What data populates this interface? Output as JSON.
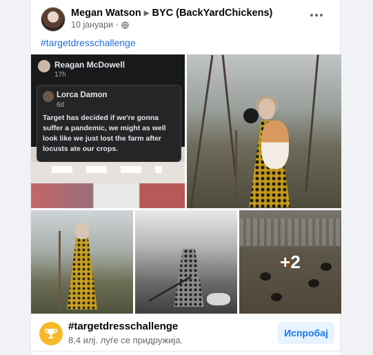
{
  "post": {
    "author": "Megan Watson",
    "group": "BYC (BackYardChickens)",
    "date": "10 јануари",
    "privacy_icon": "globe-icon",
    "more_icon": "more-options-icon",
    "hashtag": "#targetdresschallenge"
  },
  "photos": {
    "screenshot": {
      "poster_name": "Reagan McDowell",
      "poster_meta": "17h",
      "quoted_name": "Lorca Damon",
      "quoted_meta": "6d",
      "quoted_text": "Target has decided if we're gonna suffer a pandemic, we might as well look like we just lost the farm after locusts ate our crops."
    },
    "more_count": "+2"
  },
  "challenge": {
    "icon": "trophy-icon",
    "title": "#targetdresschallenge",
    "subtitle": "8,4 илј. луѓе се придружија.",
    "button_label": "Испробај",
    "colors": {
      "trophy": "#f7b928",
      "button_bg": "#e7f3ff",
      "button_text": "#1877f2",
      "link": "#216fdb"
    }
  }
}
